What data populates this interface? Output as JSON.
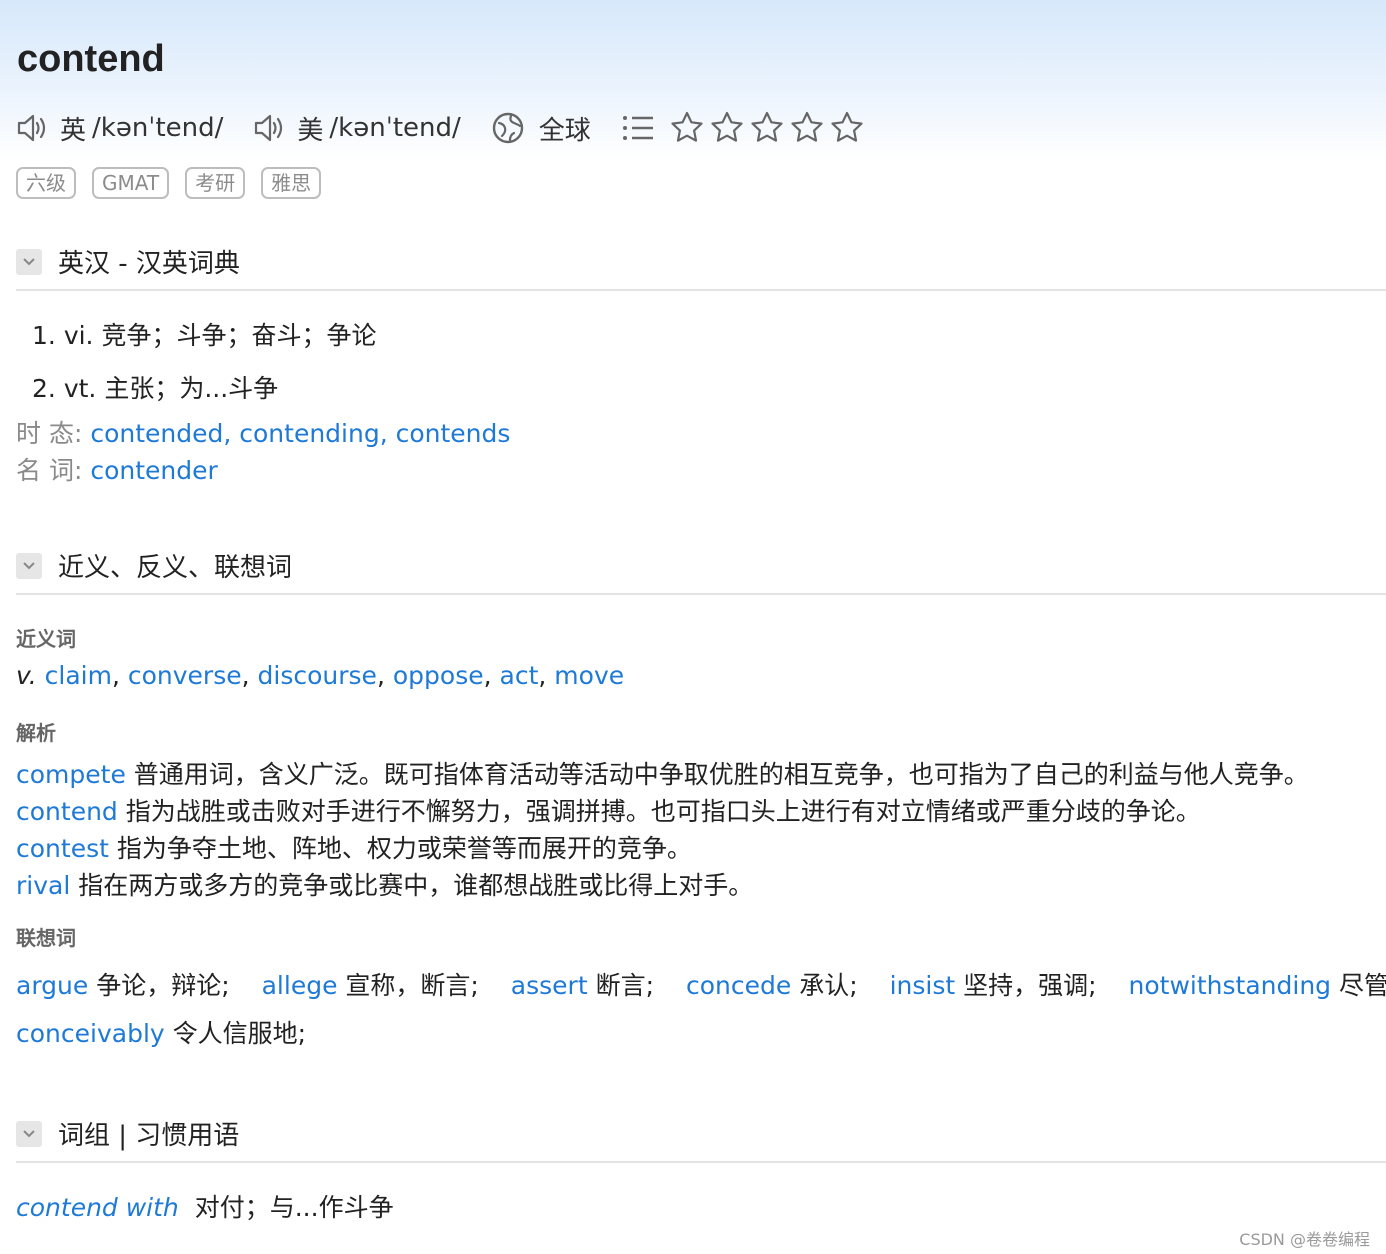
{
  "word": "contend",
  "pronunciations": [
    {
      "region": "英",
      "ipa": "/kənˈtend/"
    },
    {
      "region": "美",
      "ipa": "/kənˈtend/"
    }
  ],
  "globe_label": "全球",
  "tags": [
    "六级",
    "GMAT",
    "考研",
    "雅思"
  ],
  "sections": {
    "dict_title": "英汉 - 汉英词典",
    "syn_title": "近义、反义、联想词",
    "phrase_title": "词组 | 习惯用语"
  },
  "definitions": [
    {
      "num": "1.",
      "pos": "vi.",
      "meaning": "竞争；斗争；奋斗；争论"
    },
    {
      "num": "2.",
      "pos": "vt.",
      "meaning": "主张；为...斗争"
    }
  ],
  "inflections": {
    "tense_label": "时 态:",
    "tense_forms": "contended, contending, contends",
    "noun_label": "名 词:",
    "noun_form": "contender"
  },
  "synonyms": {
    "label": "近义词",
    "pos": "v.",
    "words": [
      "claim",
      "converse",
      "discourse",
      "oppose",
      "act",
      "move"
    ]
  },
  "analysis": {
    "label": "解析",
    "items": [
      {
        "word": "compete",
        "text": "普通用词，含义广泛。既可指体育活动等活动中争取优胜的相互竞争，也可指为了自己的利益与他人竞争。"
      },
      {
        "word": "contend",
        "text": "指为战胜或击败对手进行不懈努力，强调拼搏。也可指口头上进行有对立情绪或严重分歧的争论。"
      },
      {
        "word": "contest",
        "text": "指为争夺土地、阵地、权力或荣誉等而展开的竞争。"
      },
      {
        "word": "rival",
        "text": "指在两方或多方的竞争或比赛中，谁都想战胜或比得上对手。"
      }
    ]
  },
  "associations": {
    "label": "联想词",
    "items": [
      {
        "word": "argue",
        "meaning": "争论，辩论;"
      },
      {
        "word": "allege",
        "meaning": "宣称，断言;"
      },
      {
        "word": "assert",
        "meaning": "断言;"
      },
      {
        "word": "concede",
        "meaning": "承认;"
      },
      {
        "word": "insist",
        "meaning": "坚持，强调;"
      },
      {
        "word": "notwithstanding",
        "meaning": "尽管;"
      },
      {
        "word": "conceivably",
        "meaning": "令人信服地;"
      }
    ]
  },
  "phrases": [
    {
      "phrase": "contend with",
      "meaning": "对付；与...作斗争"
    }
  ],
  "watermark": "CSDN @卷卷编程",
  "colors": {
    "link": "#1e7ad6",
    "header_top": "#d7e8fb",
    "tag_border": "#bdbdbd"
  },
  "icons": [
    "speaker-icon",
    "globe-icon",
    "list-icon",
    "star-icon",
    "chevron-down-icon"
  ]
}
